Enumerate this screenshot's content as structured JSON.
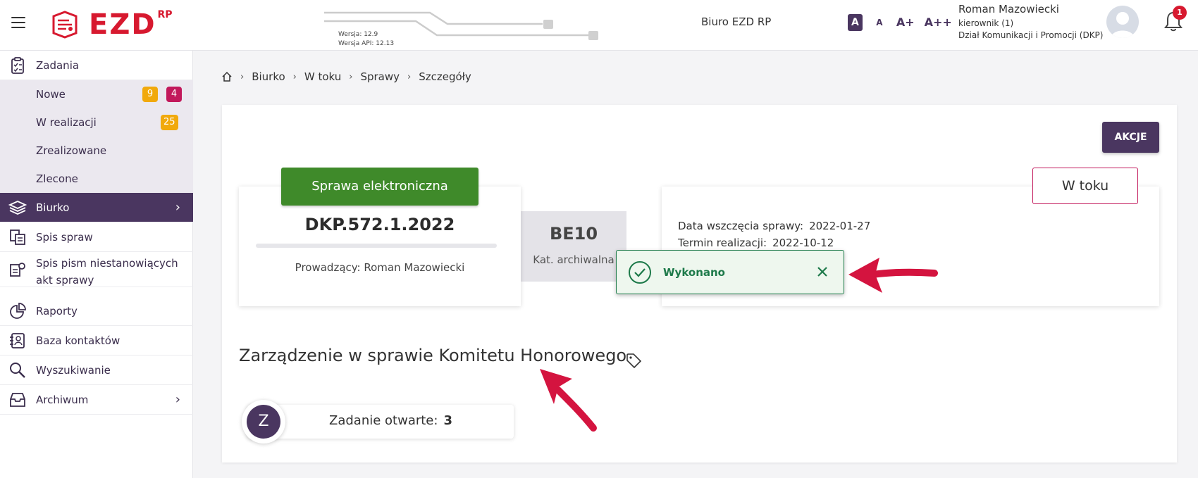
{
  "header": {
    "logo_text": "EZD",
    "logo_suffix": "RP",
    "version_label": "Wersja: 12.9",
    "api_version_label": "Wersja API: 12.13",
    "office_name": "Biuro EZD RP",
    "font_size_options": [
      "A",
      "A",
      "A+",
      "A++"
    ],
    "user": {
      "name": "Roman Mazowiecki",
      "role": "kierownik (1)",
      "department": "Dział Komunikacji i Promocji (DKP)"
    },
    "notifications_count": "1"
  },
  "sidebar": {
    "items": [
      {
        "label": "Zadania",
        "icon": "clipboard-icon"
      },
      {
        "label": "Biurko",
        "icon": "layers-icon",
        "active": true
      },
      {
        "label": "Spis spraw",
        "icon": "documents-icon"
      },
      {
        "label": "Spis pism niestanowiących",
        "label_line2": "akt sprawy",
        "icon": "documents-gear-icon"
      },
      {
        "label": "Raporty",
        "icon": "pie-chart-icon"
      },
      {
        "label": "Baza kontaktów",
        "icon": "contacts-icon"
      },
      {
        "label": "Wyszukiwanie",
        "icon": "search-icon"
      },
      {
        "label": "Archiwum",
        "icon": "archive-icon"
      }
    ],
    "subitems": [
      {
        "label": "Nowe",
        "badge_yellow": "9",
        "badge_magenta": "4"
      },
      {
        "label": "W realizacji",
        "badge_yellow": "25"
      },
      {
        "label": "Zrealizowane"
      },
      {
        "label": "Zlecone"
      }
    ]
  },
  "breadcrumb": [
    "Biurko",
    "W toku",
    "Sprawy",
    "Szczegóły"
  ],
  "actions_button": "AKCJE",
  "case": {
    "type_label": "Sprawa elektroniczna",
    "number": "DKP.572.1.2022",
    "owner_label": "Prowadzący: Roman Mazowiecki",
    "archive_code": "BE10",
    "archive_label": "Kat. archiwalna",
    "status": "W toku",
    "start_date_label": "Data wszczęcia sprawy:",
    "start_date": "2022-01-27",
    "due_date_label": "Termin realizacji:",
    "due_date": "2022-10-12",
    "title": "Zarządzenie w sprawie Komitetu Honorowego"
  },
  "toast": {
    "message": "Wykonano"
  },
  "task": {
    "avatar_letter": "Z",
    "label": "Zadanie otwarte:",
    "count": "3"
  },
  "colors": {
    "primary": "#4a3660",
    "green": "#3f8a2a",
    "success": "#1e7a4a",
    "accent": "#d7192f",
    "badge_yellow": "#f1a90c",
    "badge_magenta": "#c2185b"
  }
}
